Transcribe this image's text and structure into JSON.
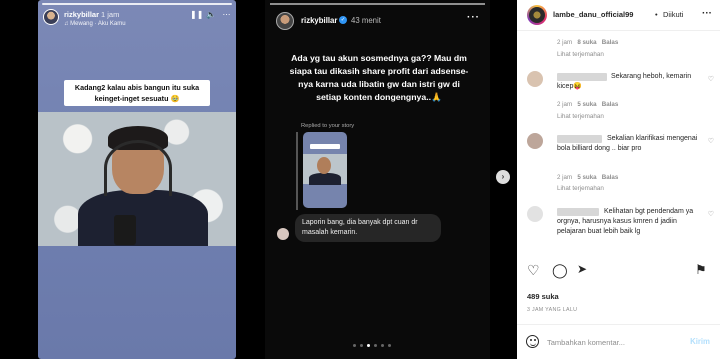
{
  "story_left": {
    "username": "rizkybillar",
    "time": "1 jam",
    "music": "♫ Mewang · Aku Kamu",
    "caption": "Kadang2 kalau abis bangun itu suka keinget-inget sesuatu 🥹"
  },
  "story_mid": {
    "username": "rizkybillar",
    "verified_mark": "✓",
    "time": "43 menit",
    "more": "···",
    "text": "Ada yg tau akun sosmednya ga?? Mau dm siapa tau dikasih share profit dari adsense-nya karna uda libatin gw dan istri gw di setiap konten dongengnya..🙏",
    "replied_label": "Replied to your story",
    "message": "Laporin bang, dia banyak dpt cuan dr masalah kemarin.",
    "next": "›"
  },
  "panel": {
    "account": "lambe_danu_official99",
    "separator": "•",
    "follow_status": "Diikuti",
    "more": "···",
    "comments": [
      {
        "text": "",
        "meta_time": "2 jam",
        "meta_likes": "8 suka",
        "reply": "Balas",
        "translate": "Lihat terjemahan"
      },
      {
        "text": "Sekarang heboh, kemarin kicep😝",
        "meta_time": "2 jam",
        "meta_likes": "5 suka",
        "reply": "Balas",
        "translate": "Lihat terjemahan"
      },
      {
        "text": "Sekalian klarifikasi mengenai bola billiard dong .. biar pro",
        "meta_time": "2 jam",
        "meta_likes": "5 suka",
        "reply": "Balas",
        "translate": "Lihat terjemahan"
      },
      {
        "text": "Kelihatan bgt pendendam ya orgnya, harusnya kasus kmren d jadiin pelajaran buat lebih baik lg",
        "meta_time": "",
        "meta_likes": "",
        "reply": "",
        "translate": ""
      }
    ],
    "likes": "489 suka",
    "posted": "3 JAM YANG LALU",
    "comment_placeholder": "Tambahkan komentar...",
    "send_label": "Kirim"
  }
}
